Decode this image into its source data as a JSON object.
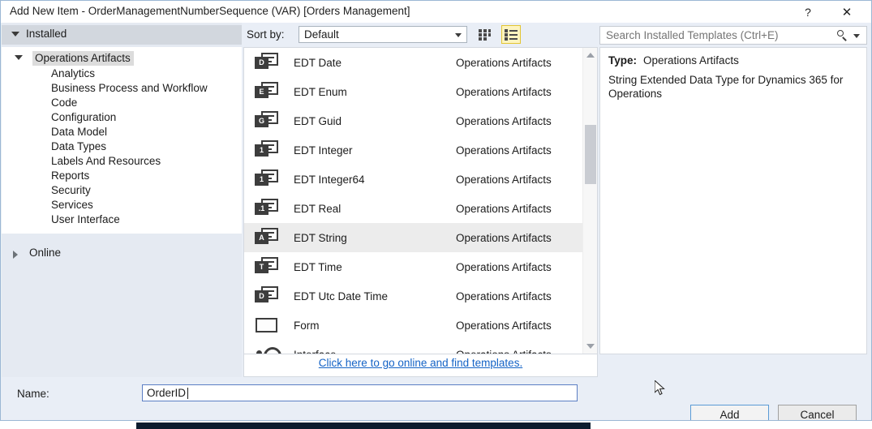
{
  "window": {
    "title": "Add New Item - OrderManagementNumberSequence (VAR) [Orders Management]",
    "help_button": "?",
    "close_button": "✕"
  },
  "left_panel": {
    "installed_header": "Installed",
    "group": {
      "label": "Operations Artifacts",
      "children": [
        "Analytics",
        "Business Process and Workflow",
        "Code",
        "Configuration",
        "Data Model",
        "Data Types",
        "Labels And Resources",
        "Reports",
        "Security",
        "Services",
        "User Interface"
      ]
    },
    "online_label": "Online"
  },
  "toolbar": {
    "sort_by_label": "Sort by:",
    "sort_by_value": "Default",
    "view_grid_icon": "medium-icons-view-icon",
    "view_list_icon": "list-view-icon",
    "view_list_selected": true
  },
  "search": {
    "placeholder": "Search Installed Templates (Ctrl+E)",
    "icon": "search-icon",
    "caret_icon": "chevron-down-icon"
  },
  "template_list": {
    "selected_index": 6,
    "items": [
      {
        "name": "EDT Date",
        "type": "Operations Artifacts",
        "icon": "edt-date-icon",
        "icon_letter": "D"
      },
      {
        "name": "EDT Enum",
        "type": "Operations Artifacts",
        "icon": "edt-enum-icon",
        "icon_letter": "E"
      },
      {
        "name": "EDT Guid",
        "type": "Operations Artifacts",
        "icon": "edt-guid-icon",
        "icon_letter": "G"
      },
      {
        "name": "EDT Integer",
        "type": "Operations Artifacts",
        "icon": "edt-integer-icon",
        "icon_letter": "1"
      },
      {
        "name": "EDT Integer64",
        "type": "Operations Artifacts",
        "icon": "edt-integer64-icon",
        "icon_letter": "1"
      },
      {
        "name": "EDT Real",
        "type": "Operations Artifacts",
        "icon": "edt-real-icon",
        "icon_letter": ".1"
      },
      {
        "name": "EDT String",
        "type": "Operations Artifacts",
        "icon": "edt-string-icon",
        "icon_letter": "A"
      },
      {
        "name": "EDT Time",
        "type": "Operations Artifacts",
        "icon": "edt-time-icon",
        "icon_letter": "T"
      },
      {
        "name": "EDT Utc Date Time",
        "type": "Operations Artifacts",
        "icon": "edt-utc-date-time-icon",
        "icon_letter": "D"
      },
      {
        "name": "Form",
        "type": "Operations Artifacts",
        "icon": "form-icon",
        "icon_letter": ""
      },
      {
        "name": "Interface",
        "type": "Operations Artifacts",
        "icon": "interface-icon",
        "icon_letter": ""
      }
    ],
    "online_link": "Click here to go online and find templates."
  },
  "details": {
    "type_label": "Type:",
    "type_value": "Operations Artifacts",
    "description": "String Extended Data Type for Dynamics 365 for Operations"
  },
  "footer": {
    "name_label": "Name:",
    "name_value": "OrderID",
    "add_button": "Add",
    "cancel_button": "Cancel"
  },
  "colors": {
    "dialog_background": "#e9eef6",
    "selection": "#ececec",
    "link": "#1463c6",
    "toggle_active_border": "#e3c533",
    "default_button_border": "#5b9bd5"
  }
}
